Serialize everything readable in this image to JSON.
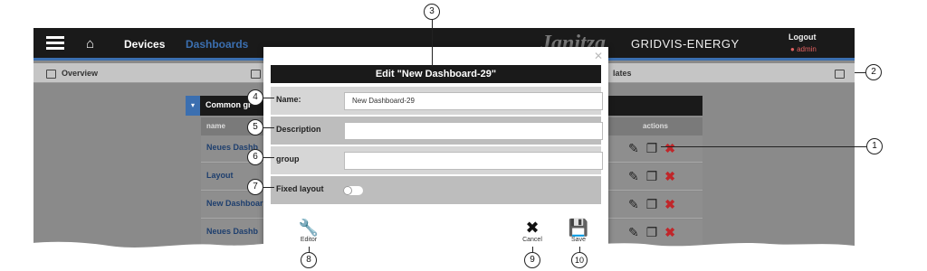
{
  "nav": {
    "devices": "Devices",
    "dashboards": "Dashboards"
  },
  "brand": {
    "janitza": "Janitza",
    "gridvis": "GRIDVIS-ENERGY"
  },
  "user": {
    "logout": "Logout",
    "name": "admin"
  },
  "tabs": [
    {
      "label": "Overview"
    },
    {
      "label": ""
    },
    {
      "label": "lates"
    },
    {
      "label": ""
    }
  ],
  "panel": {
    "title": "Common gr"
  },
  "table": {
    "headers": {
      "name": "name",
      "actions": "actions"
    },
    "rows": [
      {
        "name": "Neues Dashb"
      },
      {
        "name": "Layout"
      },
      {
        "name": "New Dashboar"
      },
      {
        "name": "Neues Dashb"
      }
    ]
  },
  "modal": {
    "title": "Edit \"New Dashboard-29\"",
    "fields": {
      "name": {
        "label": "Name:",
        "value": "New Dashboard-29"
      },
      "description": {
        "label": "Description",
        "value": ""
      },
      "group": {
        "label": "group",
        "value": ""
      },
      "fixed_layout": {
        "label": "Fixed layout",
        "enabled": false
      }
    },
    "buttons": {
      "editor": "Editor",
      "cancel": "Cancel",
      "save": "Save"
    }
  },
  "callouts": [
    "1",
    "2",
    "3",
    "4",
    "5",
    "6",
    "7",
    "8",
    "9",
    "10"
  ]
}
